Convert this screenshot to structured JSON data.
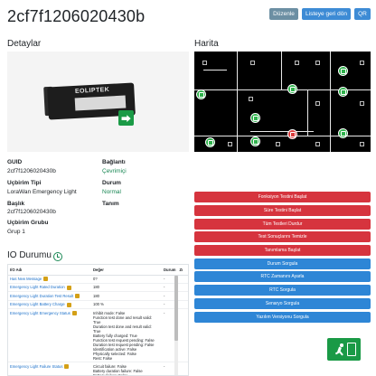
{
  "header": {
    "device_id": "2cf7f1206020430b",
    "edit_label": "Düzenle",
    "back_label": "Listeye geri dön",
    "qr_label": "QR"
  },
  "details": {
    "title": "Detaylar",
    "brand_on_image": "EOLIPTEK",
    "fields": {
      "guid_label": "GUID",
      "guid_value": "2cf7f1206020430b",
      "connection_label": "Bağlantı",
      "connection_value": "Çevrimiçi",
      "device_type_label": "Uçbirim Tipi",
      "device_type_value": "LoraWan Emergency Light",
      "status_label": "Durum",
      "status_value": "Normal",
      "title_label": "Başlık",
      "title_value": "2cf7f1206020430b",
      "description_label": "Tanım",
      "description_value": "",
      "group_label": "Uçbirim Grubu",
      "group_value": "Grup 1"
    }
  },
  "map": {
    "title": "Harita",
    "colors": {
      "background": "#000000",
      "ok_marker": "#2fb24c",
      "alert_marker": "#d93b3b"
    }
  },
  "actions": {
    "buttons": [
      {
        "label": "Fonksiyon Testini Başlat",
        "color": "red"
      },
      {
        "label": "Süre Testini Başlat",
        "color": "red"
      },
      {
        "label": "Tüm Testleri Durdur",
        "color": "red"
      },
      {
        "label": "Test Sonuçlarını Temizle",
        "color": "red"
      },
      {
        "label": "Tanımlama Başlat",
        "color": "red"
      },
      {
        "label": "Durum Sorgula",
        "color": "blue"
      },
      {
        "label": "RTC Zamanını Ayarla",
        "color": "blue"
      },
      {
        "label": "RTC Sorgula",
        "color": "blue"
      },
      {
        "label": "Senaryo Sorgula",
        "color": "blue"
      },
      {
        "label": "Yazılım Versiyonu Sorgula",
        "color": "blue"
      }
    ]
  },
  "io": {
    "title": "IO Durumu",
    "columns": [
      "I/O Adı",
      "Değer",
      "Durum",
      "Zı"
    ],
    "rows": [
      {
        "name": "Has New Message",
        "value": "0?",
        "status": "-"
      },
      {
        "name": "Emergency Light Rated Duration",
        "value": "180",
        "status": "-"
      },
      {
        "name": "Emergency Light Duration Test Result",
        "value": "180",
        "status": "-"
      },
      {
        "name": "Emergency Light Battery Charge",
        "value": "100 %",
        "status": "-"
      },
      {
        "name": "Emergency Light Emergency Status",
        "value": "Inhibit mode: False\nFunction test done and result valid: True\nDuration test done and result valid: True\nBattery fully charged: True\nFunction test request pending: False\nDuration test request pending: False\nIdentification active: False\nPhysically selected: False\nRest: False",
        "status": "-"
      },
      {
        "name": "Emergency Light Failure Status",
        "value": "Circuit failure: False\nBattery duration failure: False\nBattery failure: False",
        "status": "-"
      }
    ]
  }
}
